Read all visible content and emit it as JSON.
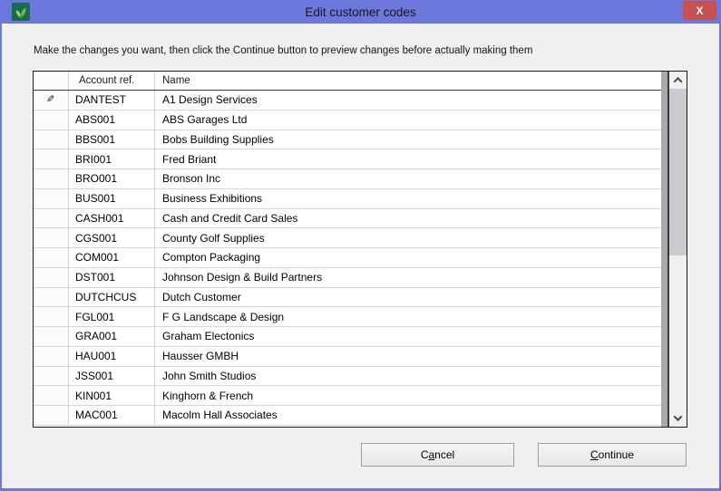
{
  "window": {
    "title": "Edit customer codes",
    "close_glyph": "X"
  },
  "instruction": "Make the changes you want, then click the Continue button to preview changes before actually making them",
  "table": {
    "columns": [
      "Account ref.",
      "Name"
    ],
    "edit_icon_glyph": "✎",
    "rows": [
      {
        "ref": "DANTEST",
        "name": "A1 Design Services",
        "editing": true
      },
      {
        "ref": "ABS001",
        "name": "ABS Garages Ltd"
      },
      {
        "ref": "BBS001",
        "name": "Bobs Building Supplies"
      },
      {
        "ref": "BRI001",
        "name": "Fred Briant"
      },
      {
        "ref": "BRO001",
        "name": "Bronson Inc"
      },
      {
        "ref": "BUS001",
        "name": "Business Exhibitions"
      },
      {
        "ref": "CASH001",
        "name": "Cash and Credit Card Sales"
      },
      {
        "ref": "CGS001",
        "name": "County Golf Supplies"
      },
      {
        "ref": "COM001",
        "name": "Compton Packaging"
      },
      {
        "ref": "DST001",
        "name": "Johnson Design & Build Partners"
      },
      {
        "ref": "DUTCHCUS",
        "name": "Dutch Customer"
      },
      {
        "ref": "FGL001",
        "name": "F G Landscape & Design"
      },
      {
        "ref": "GRA001",
        "name": "Graham Electonics"
      },
      {
        "ref": "HAU001",
        "name": "Hausser GMBH"
      },
      {
        "ref": "JSS001",
        "name": "John Smith Studios"
      },
      {
        "ref": "KIN001",
        "name": "Kinghorn & French"
      },
      {
        "ref": "MAC001",
        "name": "Macolm Hall Associates"
      }
    ]
  },
  "buttons": {
    "cancel": {
      "pre": "C",
      "accel": "a",
      "post": "ncel"
    },
    "continue": {
      "pre": "",
      "accel": "C",
      "post": "ontinue"
    }
  },
  "colors": {
    "titlebar": "#6d78dc",
    "close_red": "#c75050",
    "icon_bg_green": "#1b6a52",
    "icon_leaf_light": "#a6d65e",
    "icon_leaf_dark": "#6fbe44"
  }
}
